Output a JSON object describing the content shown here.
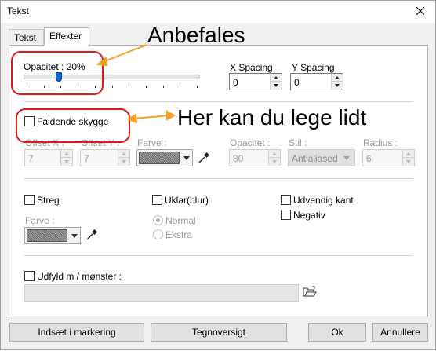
{
  "window": {
    "title": "Tekst"
  },
  "tabs": [
    {
      "label": "Tekst",
      "active": false
    },
    {
      "label": "Effekter",
      "active": true
    }
  ],
  "opacity": {
    "label": "Opacitet : 20%",
    "value_percent": 20
  },
  "x_spacing": {
    "label": "X Spacing",
    "value": "0"
  },
  "y_spacing": {
    "label": "Y Spacing",
    "value": "0"
  },
  "shadow": {
    "checkbox_label": "Faldende skygge",
    "checked": false,
    "offset_x": {
      "label": "Offset X :",
      "value": "7"
    },
    "offset_y": {
      "label": "Offset Y :",
      "value": "7"
    },
    "color": {
      "label": "Farve :"
    },
    "opacity": {
      "label": "Opacitet :",
      "value": "80"
    },
    "style": {
      "label": "Stil :",
      "value": "Antialiased"
    },
    "radius": {
      "label": "Radius :",
      "value": "6"
    }
  },
  "stroke": {
    "label": "Streg",
    "checked": false,
    "color_label": "Farve :"
  },
  "blur": {
    "label": "Uklar(blur)",
    "checked": false,
    "options": [
      {
        "label": "Normal",
        "selected": true
      },
      {
        "label": "Ekstra",
        "selected": false
      }
    ]
  },
  "outer_edge": {
    "label": "Udvendig kant",
    "checked": false
  },
  "negative": {
    "label": "Negativ",
    "checked": false
  },
  "fill_pattern": {
    "label": "Udfyld m / mønster :",
    "checked": false,
    "value": ""
  },
  "buttons": {
    "insert": "Indsæt i markering",
    "charmap": "Tegnoversigt",
    "ok": "Ok",
    "cancel": "Annullere"
  },
  "annotations": {
    "recommended": "Anbefales",
    "play": "Her kan du lege lidt",
    "highlight_color": "#e0161b",
    "arrow_color": "#f5a020"
  },
  "colors": {
    "accent": "#0a6ad6",
    "panel_bg": "#ffffff",
    "window_bg": "#f0f0f0"
  }
}
